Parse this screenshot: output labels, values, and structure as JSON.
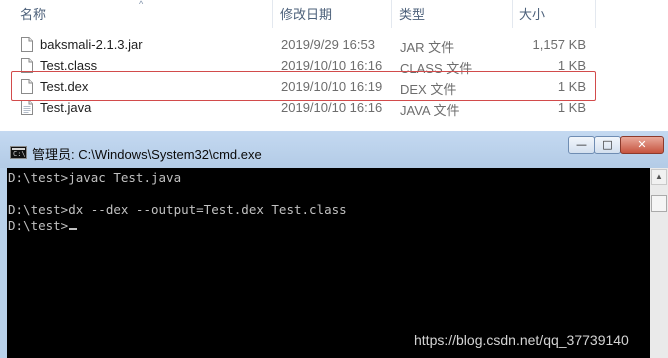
{
  "explorer": {
    "columns": {
      "name": "名称",
      "date": "修改日期",
      "type": "类型",
      "size": "大小"
    },
    "files": [
      {
        "name": "baksmali-2.1.3.jar",
        "date": "2019/9/29 16:53",
        "type": "JAR 文件",
        "size": "1,157 KB",
        "icon": "jar-file-icon"
      },
      {
        "name": "Test.class",
        "date": "2019/10/10 16:16",
        "type": "CLASS 文件",
        "size": "1 KB",
        "icon": "file-icon"
      },
      {
        "name": "Test.dex",
        "date": "2019/10/10 16:19",
        "type": "DEX 文件",
        "size": "1 KB",
        "icon": "file-icon"
      },
      {
        "name": "Test.java",
        "date": "2019/10/10 16:16",
        "type": "JAVA 文件",
        "size": "1 KB",
        "icon": "text-file-icon"
      }
    ],
    "highlight_color": "#d24b4b"
  },
  "cmd": {
    "title": "管理员: C:\\Windows\\System32\\cmd.exe",
    "lines": [
      "D:\\test>javac Test.java",
      "",
      "D:\\test>dx --dex --output=Test.dex Test.class",
      "D:\\test>"
    ],
    "minimize_glyph": "—",
    "maximize_glyph": "□",
    "close_glyph": "✕",
    "icon": "cmd-icon",
    "icon_text": "C:\\"
  },
  "watermark": "https://blog.csdn.net/qq_37739140"
}
